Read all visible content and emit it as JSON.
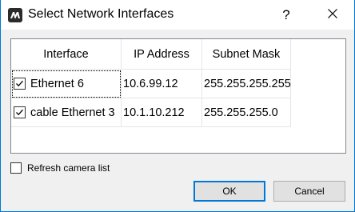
{
  "window": {
    "title": "Select Network Interfaces",
    "help_label": "?",
    "app_icon": "app-logo-icon",
    "close_icon": "close-icon"
  },
  "table": {
    "columns": [
      "Interface",
      "IP Address",
      "Subnet Mask"
    ],
    "rows": [
      {
        "checked": true,
        "interface": "Ethernet 6",
        "ip": "10.6.99.12",
        "mask": "255.255.255.255"
      },
      {
        "checked": true,
        "interface": "cable Ethernet 3",
        "ip": "10.1.10.212",
        "mask": "255.255.255.0"
      }
    ]
  },
  "refresh": {
    "label": "Refresh camera list",
    "checked": false
  },
  "buttons": {
    "ok": "OK",
    "cancel": "Cancel"
  },
  "colors": {
    "accent": "#0078d7",
    "dialog_bg": "#f0f0f0"
  }
}
